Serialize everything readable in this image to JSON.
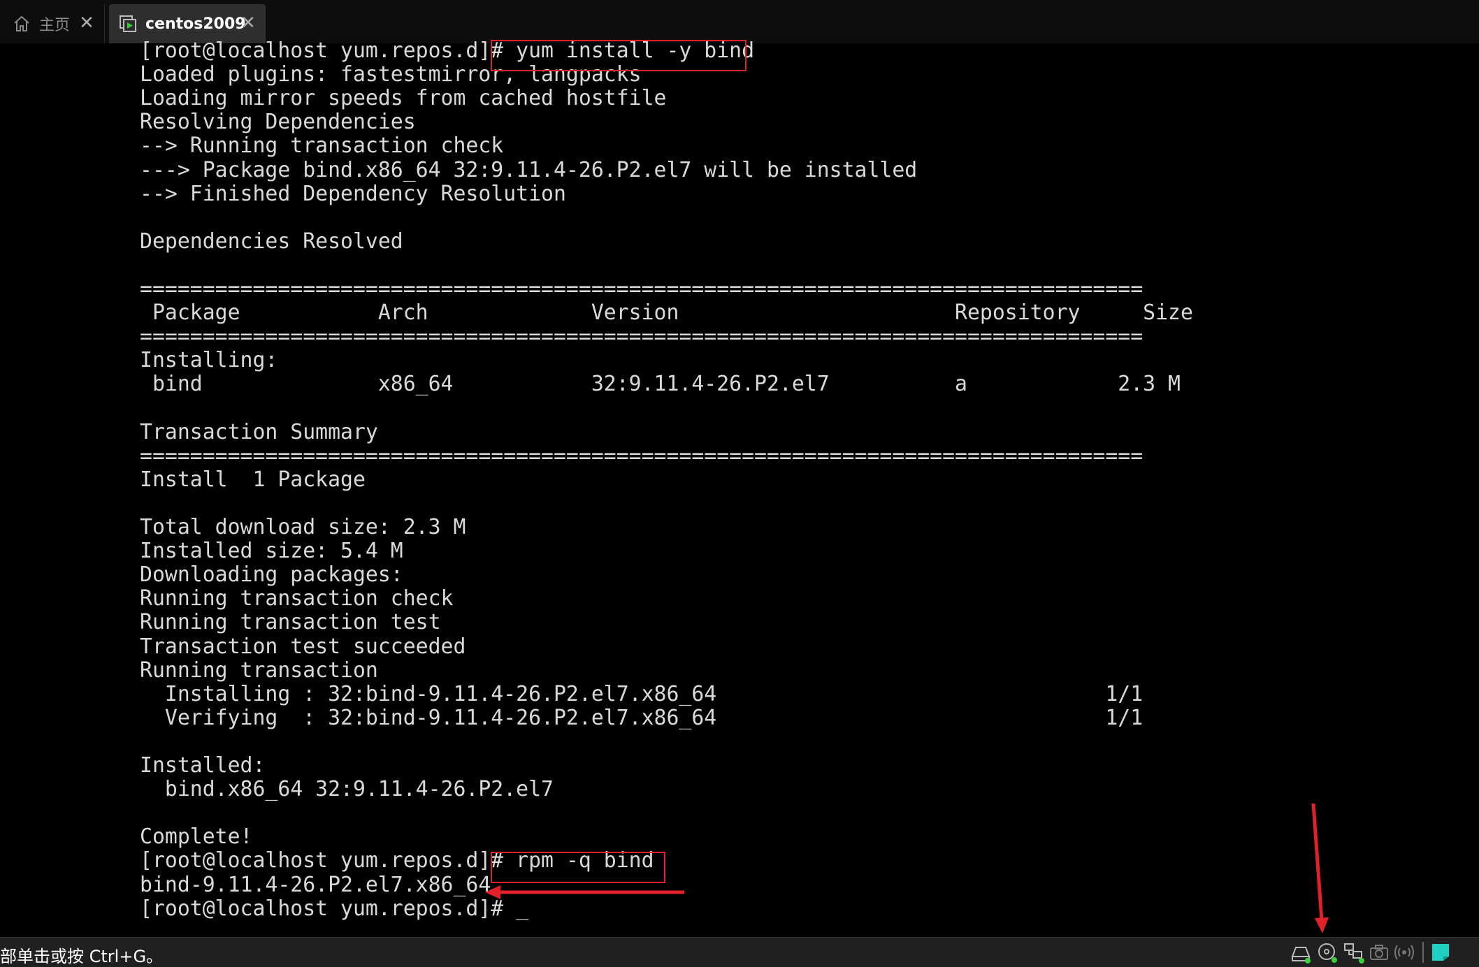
{
  "tabs": [
    {
      "label": "主页",
      "icon": "home-icon"
    },
    {
      "label": "centos2009",
      "icon": "vm-icon"
    }
  ],
  "terminal": {
    "lines": [
      "[root@localhost yum.repos.d]# yum install -y bind",
      "Loaded plugins: fastestmirror, langpacks",
      "Loading mirror speeds from cached hostfile",
      "Resolving Dependencies",
      "--> Running transaction check",
      "---> Package bind.x86_64 32:9.11.4-26.P2.el7 will be installed",
      "--> Finished Dependency Resolution",
      "",
      "Dependencies Resolved",
      "",
      "================================================================================",
      " Package           Arch             Version                      Repository     Size",
      "================================================================================",
      "Installing:",
      " bind              x86_64           32:9.11.4-26.P2.el7          a            2.3 M",
      "",
      "Transaction Summary",
      "================================================================================",
      "Install  1 Package",
      "",
      "Total download size: 2.3 M",
      "Installed size: 5.4 M",
      "Downloading packages:",
      "Running transaction check",
      "Running transaction test",
      "Transaction test succeeded",
      "Running transaction",
      "  Installing : 32:bind-9.11.4-26.P2.el7.x86_64                               1/1",
      "  Verifying  : 32:bind-9.11.4-26.P2.el7.x86_64                               1/1",
      "",
      "Installed:",
      "  bind.x86_64 32:9.11.4-26.P2.el7",
      "",
      "Complete!",
      "[root@localhost yum.repos.d]# rpm -q bind",
      "bind-9.11.4-26.P2.el7.x86_64",
      "[root@localhost yum.repos.d]# _"
    ]
  },
  "statusbar": {
    "hint": "部单击或按 Ctrl+G。",
    "icons": [
      "hard-disk-icon",
      "cd-drive-icon",
      "network-adapter-icon",
      "camera-icon",
      "sound-icon",
      "message-icon"
    ]
  },
  "colors": {
    "annotation": "#e0202a",
    "terminal_text": "#d9d9d9",
    "status_ok": "#3ad13a",
    "message_icon": "#1fd0c0"
  }
}
